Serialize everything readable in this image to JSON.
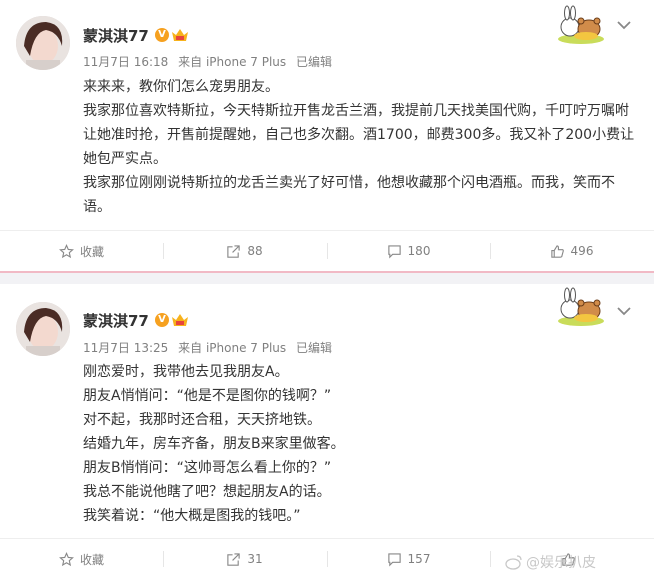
{
  "posts": [
    {
      "username": "蒙淇淇77",
      "badge": "V",
      "time": "11月7日 16:18",
      "source": "来自 iPhone 7 Plus",
      "edited": "已编辑",
      "lines": [
        "来来来，教你们怎么宠男朋友。",
        "我家那位喜欢特斯拉，今天特斯拉开售龙舌兰酒，我提前几天找美国代购，千叮咛万嘱咐让她准时抢，开售前提醒她，自己也多次翻。酒1700，邮费300多。我又补了200小费让她包严实点。",
        "我家那位刚刚说特斯拉的龙舌兰卖光了好可惜，他想收藏那个闪电酒瓶。而我，笑而不语。"
      ],
      "actions": {
        "favorite": "收藏",
        "repost": "88",
        "comment": "180",
        "like": "496"
      }
    },
    {
      "username": "蒙淇淇77",
      "badge": "V",
      "time": "11月7日 13:25",
      "source": "来自 iPhone 7 Plus",
      "edited": "已编辑",
      "lines": [
        "刚恋爱时，我带他去见我朋友A。",
        "朋友A悄悄问：“他是不是图你的钱啊？”",
        "对不起，我那时还合租，天天挤地铁。",
        "结婚九年，房车齐备，朋友B来家里做客。",
        "朋友B悄悄问：“这帅哥怎么看上你的？”",
        "我总不能说他瞎了吧？想起朋友A的话。",
        "我笑着说：“他大概是图我的钱吧。”"
      ],
      "actions": {
        "favorite": "收藏",
        "repost": "31",
        "comment": "157",
        "like": ""
      }
    }
  ],
  "watermark": "@娱乐扒皮",
  "colors": {
    "badge": "#f6a120",
    "separator": "#f1b9c5",
    "meta": "#808080"
  }
}
